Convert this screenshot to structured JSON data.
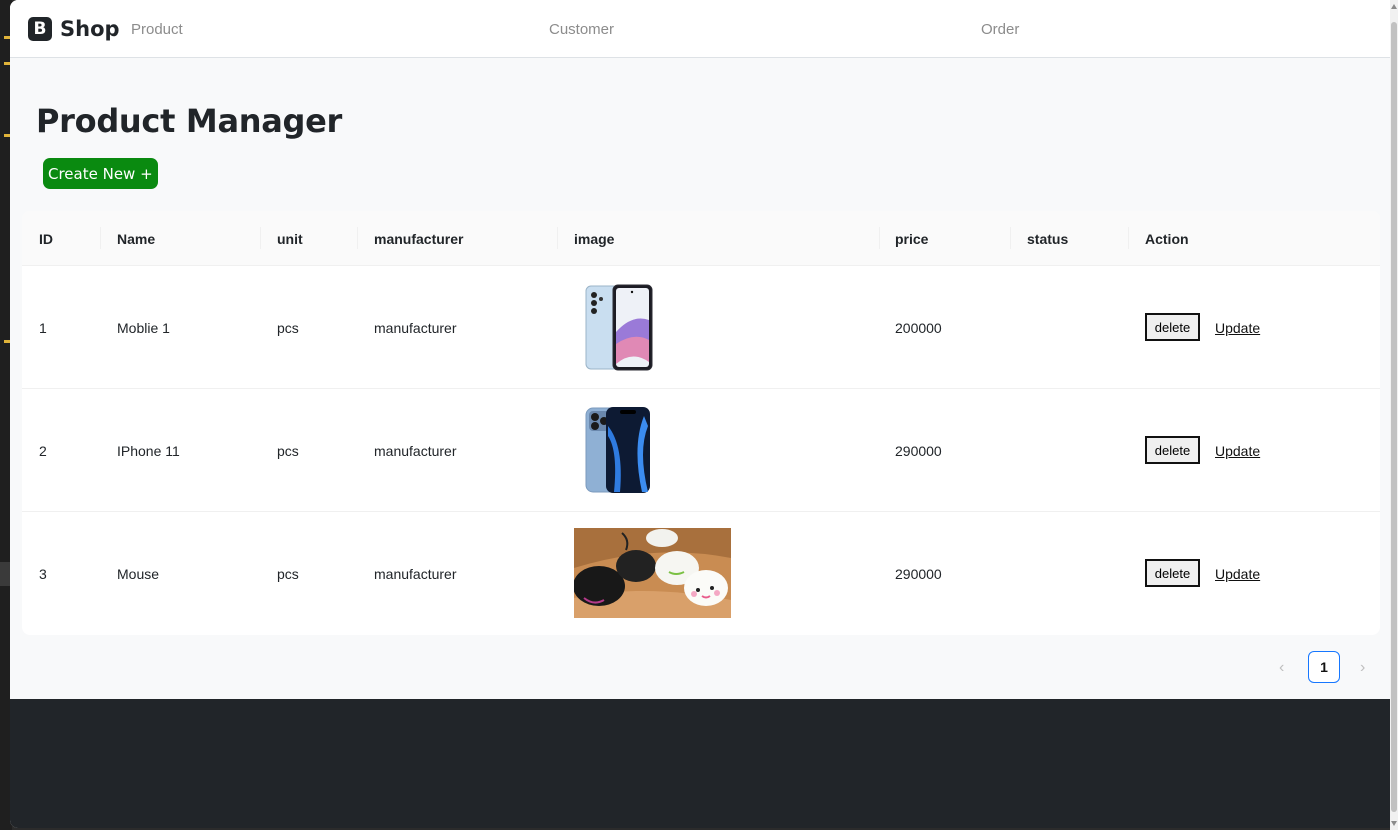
{
  "navbar": {
    "brand_letter": "B",
    "brand_name": "Shop",
    "links": [
      "Product",
      "Customer",
      "Order"
    ]
  },
  "page": {
    "title": "Product Manager",
    "create_button": "Create New +"
  },
  "table": {
    "headers": [
      "ID",
      "Name",
      "unit",
      "manufacturer",
      "image",
      "price",
      "status",
      "Action"
    ],
    "rows": [
      {
        "id": "1",
        "name": "Moblie 1",
        "unit": "pcs",
        "manufacturer": "manufacturer",
        "image": "phone-image",
        "price": "200000",
        "status": "",
        "delete": "delete",
        "update": "Update"
      },
      {
        "id": "2",
        "name": "IPhone 11",
        "unit": "pcs",
        "manufacturer": "manufacturer",
        "image": "iphone-image",
        "price": "290000",
        "status": "",
        "delete": "delete",
        "update": "Update"
      },
      {
        "id": "3",
        "name": "Mouse",
        "unit": "pcs",
        "manufacturer": "manufacturer",
        "image": "mouse-image",
        "price": "290000",
        "status": "",
        "delete": "delete",
        "update": "Update"
      }
    ]
  },
  "pagination": {
    "prev": "‹",
    "current": "1",
    "next": "›"
  },
  "colors": {
    "create_button": "#0a8a10",
    "footer": "#212529",
    "pagination_active_border": "#1677ff"
  }
}
